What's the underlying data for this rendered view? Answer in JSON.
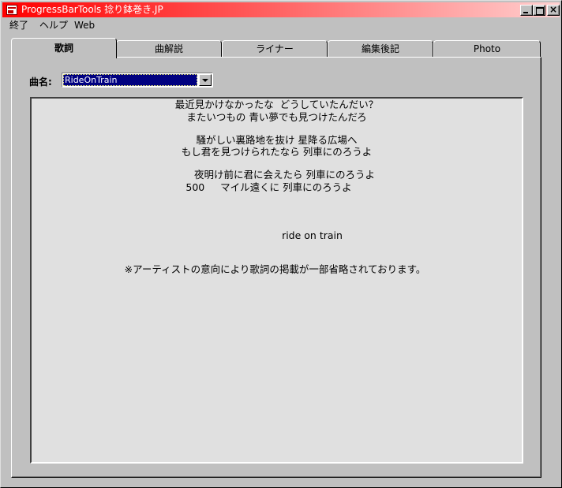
{
  "window": {
    "title": "ProgressBarTools  捻り鉢巻き.JP",
    "close_glyph": "×"
  },
  "menu": [
    "終了",
    "ヘルプ",
    "Web"
  ],
  "tabs": [
    {
      "label": "歌詞",
      "active": true
    },
    {
      "label": "曲解説",
      "active": false
    },
    {
      "label": "ライナー",
      "active": false
    },
    {
      "label": "編集後記",
      "active": false
    },
    {
      "label": "Photo",
      "active": false
    }
  ],
  "song": {
    "label": "曲名:",
    "selected": "RideOnTrain"
  },
  "lyrics": [
    "最近見かけなかったな  どうしていたんだい？",
    "またいつもの 青い夢でも見つけたんだろ",
    "騒がしい裏路地を抜け 星降る広場へ",
    "もし君を見つけられたなら 列車にのろうよ",
    "夜明け前に君に会えたら 列車にのろうよ",
    "500     マイル遠くに 列車にのろうよ",
    "ride on train",
    "※アーティストの意向により歌詞の掲載が一部省略されております。"
  ]
}
